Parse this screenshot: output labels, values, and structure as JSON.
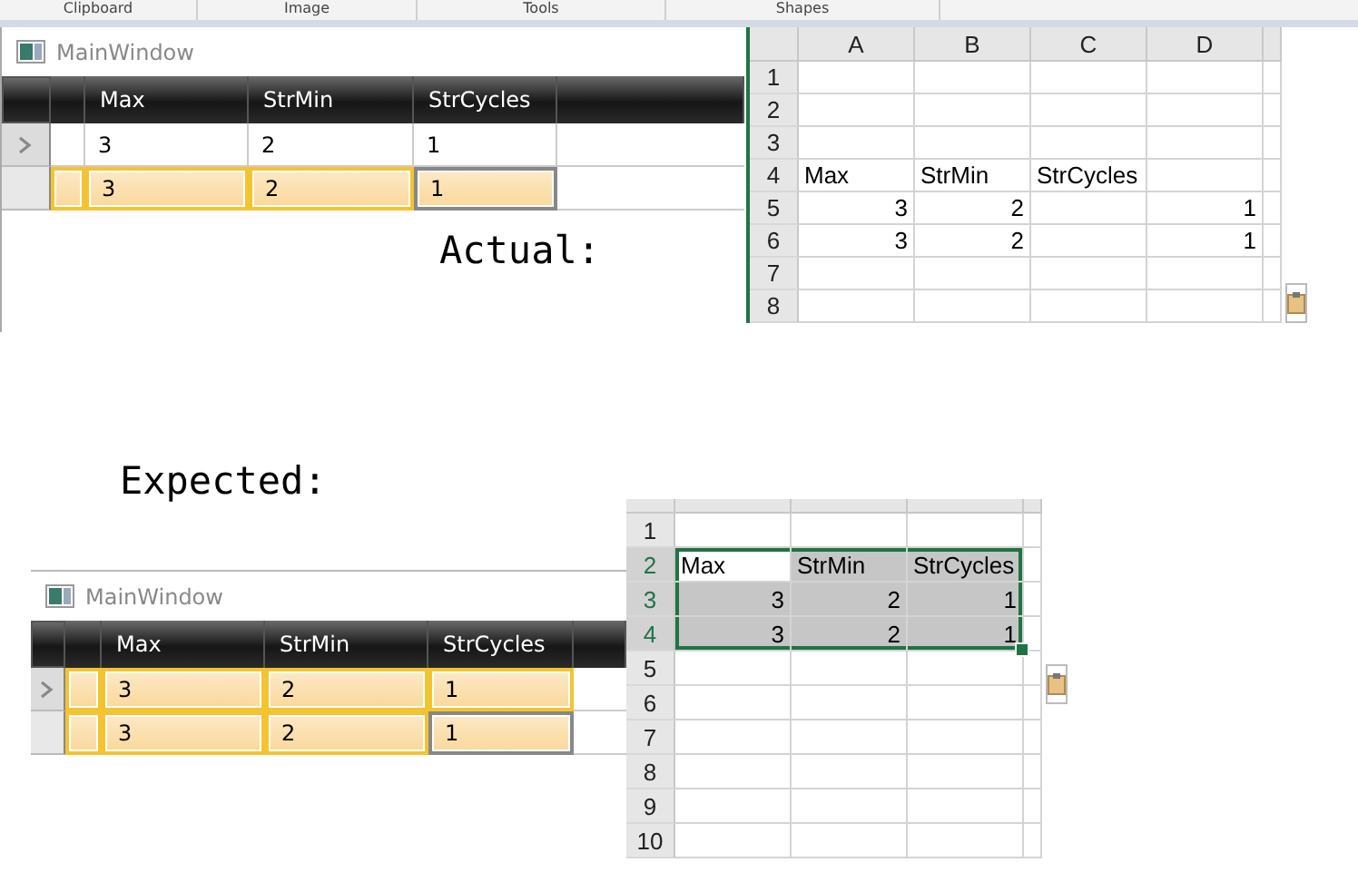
{
  "ribbon": {
    "groups": [
      "Clipboard",
      "Image",
      "Tools",
      "Shapes"
    ]
  },
  "actual": {
    "caption": "Actual:",
    "window": {
      "title": "MainWindow",
      "columns": [
        "Max",
        "StrMin",
        "StrCycles"
      ],
      "rows": [
        {
          "current": true,
          "selected": false,
          "cells": [
            {
              "text": "3",
              "focused": false
            },
            {
              "text": "2",
              "focused": false
            },
            {
              "text": "1",
              "focused": false
            }
          ]
        },
        {
          "current": false,
          "selected": true,
          "cells": [
            {
              "text": "3",
              "focused": false
            },
            {
              "text": "2",
              "focused": false
            },
            {
              "text": "1",
              "focused": true
            }
          ]
        }
      ]
    },
    "sheet": {
      "columns": [
        "A",
        "B",
        "C",
        "D"
      ],
      "rows": [
        {
          "number": "1",
          "cells": [
            {
              "kind": "blank"
            },
            {
              "kind": "blank"
            },
            {
              "kind": "blank"
            },
            {
              "kind": "blank"
            }
          ]
        },
        {
          "number": "2",
          "cells": [
            {
              "kind": "blank"
            },
            {
              "kind": "blank"
            },
            {
              "kind": "blank"
            },
            {
              "kind": "blank"
            }
          ]
        },
        {
          "number": "3",
          "cells": [
            {
              "kind": "blank"
            },
            {
              "kind": "blank"
            },
            {
              "kind": "blank"
            },
            {
              "kind": "blank"
            }
          ]
        },
        {
          "number": "4",
          "cells": [
            {
              "kind": "text",
              "text": "Max"
            },
            {
              "kind": "text",
              "text": "StrMin"
            },
            {
              "kind": "text",
              "text": "StrCycles"
            },
            {
              "kind": "blank"
            }
          ]
        },
        {
          "number": "5",
          "cells": [
            {
              "kind": "number",
              "text": "3"
            },
            {
              "kind": "number",
              "text": "2"
            },
            {
              "kind": "blank"
            },
            {
              "kind": "number",
              "text": "1"
            }
          ]
        },
        {
          "number": "6",
          "cells": [
            {
              "kind": "number",
              "text": "3"
            },
            {
              "kind": "number",
              "text": "2"
            },
            {
              "kind": "blank"
            },
            {
              "kind": "number",
              "text": "1"
            }
          ]
        },
        {
          "number": "7",
          "cells": [
            {
              "kind": "blank"
            },
            {
              "kind": "blank"
            },
            {
              "kind": "blank"
            },
            {
              "kind": "blank"
            }
          ]
        },
        {
          "number": "8",
          "cells": [
            {
              "kind": "blank"
            },
            {
              "kind": "blank"
            },
            {
              "kind": "blank"
            },
            {
              "kind": "blank"
            }
          ]
        }
      ]
    }
  },
  "expected": {
    "caption": "Expected:",
    "window": {
      "title": "MainWindow",
      "columns": [
        "Max",
        "StrMin",
        "StrCycles"
      ],
      "rows": [
        {
          "current": true,
          "selected": true,
          "cells": [
            {
              "text": "3",
              "focused": false
            },
            {
              "text": "2",
              "focused": false
            },
            {
              "text": "1",
              "focused": false
            }
          ]
        },
        {
          "current": false,
          "selected": true,
          "cells": [
            {
              "text": "3",
              "focused": false
            },
            {
              "text": "2",
              "focused": false
            },
            {
              "text": "1",
              "focused": true
            }
          ]
        }
      ]
    },
    "sheet": {
      "rows": [
        {
          "number": "1",
          "cells": [
            {
              "kind": "blank"
            },
            {
              "kind": "blank"
            },
            {
              "kind": "blank"
            }
          ]
        },
        {
          "number": "2",
          "cells": [
            {
              "kind": "text",
              "text": "Max",
              "selected": true,
              "active": true
            },
            {
              "kind": "text",
              "text": "StrMin",
              "selected": true,
              "active": false
            },
            {
              "kind": "text",
              "text": "StrCycles",
              "selected": true,
              "active": false
            }
          ]
        },
        {
          "number": "3",
          "cells": [
            {
              "kind": "number",
              "text": "3",
              "selected": true,
              "active": false
            },
            {
              "kind": "number",
              "text": "2",
              "selected": true,
              "active": false
            },
            {
              "kind": "number",
              "text": "1",
              "selected": true,
              "active": false
            }
          ]
        },
        {
          "number": "4",
          "cells": [
            {
              "kind": "number",
              "text": "3",
              "selected": true,
              "active": false
            },
            {
              "kind": "number",
              "text": "2",
              "selected": true,
              "active": false
            },
            {
              "kind": "number",
              "text": "1",
              "selected": true,
              "active": false
            }
          ]
        },
        {
          "number": "5",
          "cells": [
            {
              "kind": "blank"
            },
            {
              "kind": "blank"
            },
            {
              "kind": "blank"
            }
          ]
        },
        {
          "number": "6",
          "cells": [
            {
              "kind": "blank"
            },
            {
              "kind": "blank"
            },
            {
              "kind": "blank"
            }
          ]
        },
        {
          "number": "7",
          "cells": [
            {
              "kind": "blank"
            },
            {
              "kind": "blank"
            },
            {
              "kind": "blank"
            }
          ]
        },
        {
          "number": "8",
          "cells": [
            {
              "kind": "blank"
            },
            {
              "kind": "blank"
            },
            {
              "kind": "blank"
            }
          ]
        },
        {
          "number": "9",
          "cells": [
            {
              "kind": "blank"
            },
            {
              "kind": "blank"
            },
            {
              "kind": "blank"
            }
          ]
        },
        {
          "number": "10",
          "cells": [
            {
              "kind": "blank"
            },
            {
              "kind": "blank"
            },
            {
              "kind": "blank"
            }
          ]
        }
      ]
    }
  }
}
